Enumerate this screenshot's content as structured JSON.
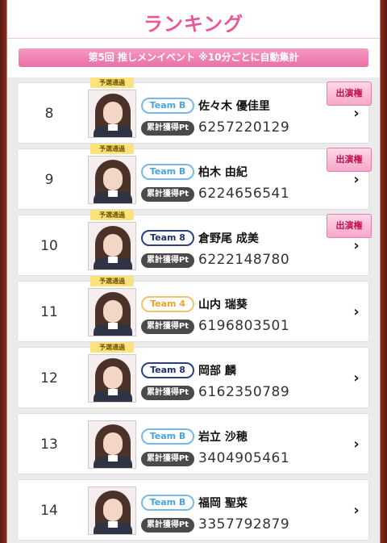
{
  "header": {
    "title": "ランキング",
    "event_banner": "第5回 推しメンイベント ※10分ごとに自動集計"
  },
  "labels": {
    "pt_label": "累計獲得Pt",
    "qualified_badge": "予選通過",
    "entry_ribbon": "出演権",
    "chevron": "›"
  },
  "colors": {
    "accent_pink": "#e8579a",
    "team_b": "#4aa3dd",
    "team_8": "#1f2f6f",
    "team_4": "#e9a52e"
  },
  "rows": [
    {
      "rank": "8",
      "team": "Team B",
      "team_style": "light",
      "name": "佐々木 優佳里",
      "points": "6257220129",
      "qualified": true,
      "entry": true
    },
    {
      "rank": "9",
      "team": "Team B",
      "team_style": "light",
      "name": "柏木 由紀",
      "points": "6224656541",
      "qualified": true,
      "entry": true
    },
    {
      "rank": "10",
      "team": "Team 8",
      "team_style": "navy",
      "name": "倉野尾 成美",
      "points": "6222148780",
      "qualified": true,
      "entry": true
    },
    {
      "rank": "11",
      "team": "Team 4",
      "team_style": "orange",
      "name": "山内 瑞葵",
      "points": "6196803501",
      "qualified": true,
      "entry": false
    },
    {
      "rank": "12",
      "team": "Team 8",
      "team_style": "navy",
      "name": "岡部 麟",
      "points": "6162350789",
      "qualified": true,
      "entry": false
    },
    {
      "rank": "13",
      "team": "Team B",
      "team_style": "light",
      "name": "岩立 沙穂",
      "points": "3404905461",
      "qualified": false,
      "entry": false
    },
    {
      "rank": "14",
      "team": "Team B",
      "team_style": "light",
      "name": "福岡 聖菜",
      "points": "3357792879",
      "qualified": false,
      "entry": false
    }
  ]
}
